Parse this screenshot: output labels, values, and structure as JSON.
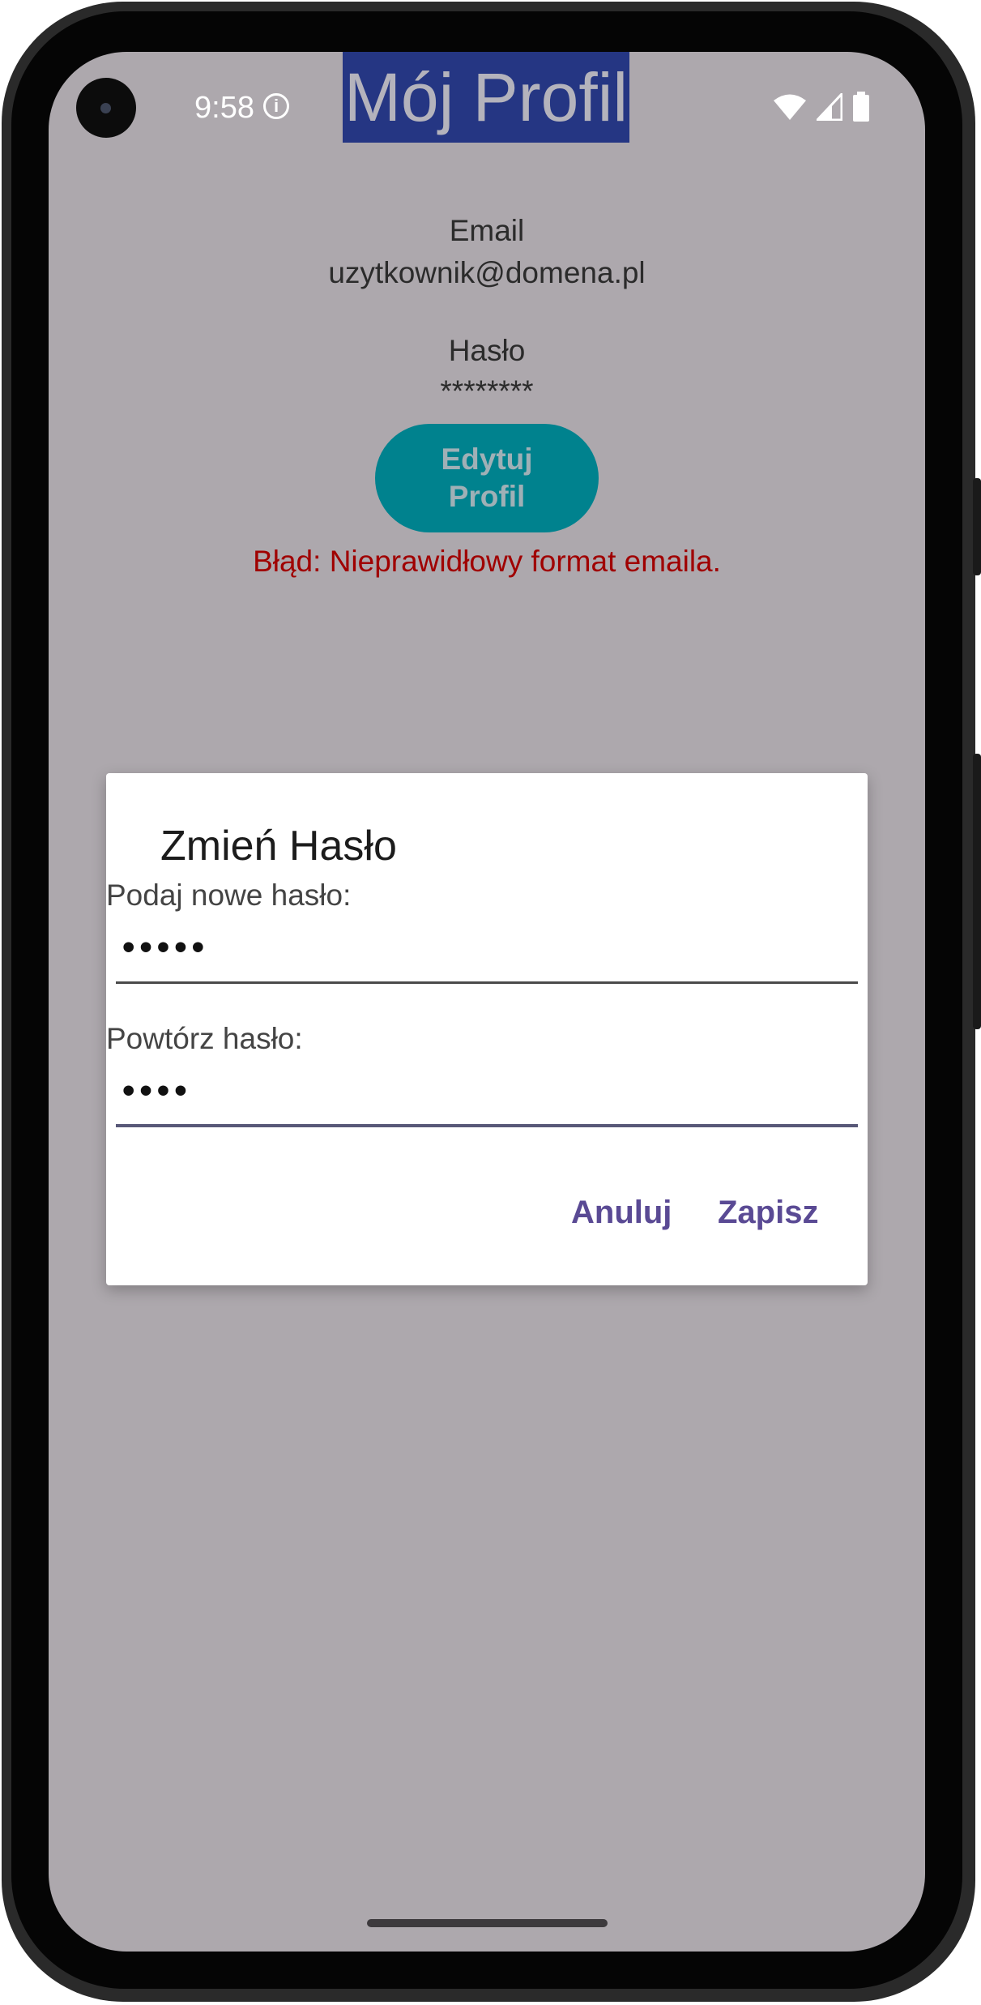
{
  "status_bar": {
    "time": "9:58",
    "info_icon": "info-icon",
    "wifi_icon": "wifi-icon",
    "signal_icon": "signal-icon",
    "battery_icon": "battery-icon"
  },
  "app_bar": {
    "title": "Mój Profil"
  },
  "profile": {
    "email_label": "Email",
    "email_value": "uzytkownik@domena.pl",
    "password_label": "Hasło",
    "password_value": "********",
    "edit_button_label": "Edytuj Profil",
    "error_text": "Błąd: Nieprawidłowy format emaila."
  },
  "dialog": {
    "title": "Zmień Hasło",
    "new_password_label": "Podaj nowe hasło:",
    "new_password_value": "•••••",
    "repeat_password_label": "Powtórz hasło:",
    "repeat_password_value": "••••",
    "cancel_label": "Anuluj",
    "save_label": "Zapisz"
  },
  "colors": {
    "screen_background": "#ada8ad",
    "title_background": "#253683",
    "edit_button": "#00828e",
    "error": "#a00000",
    "dialog_action": "#5a4a94"
  }
}
